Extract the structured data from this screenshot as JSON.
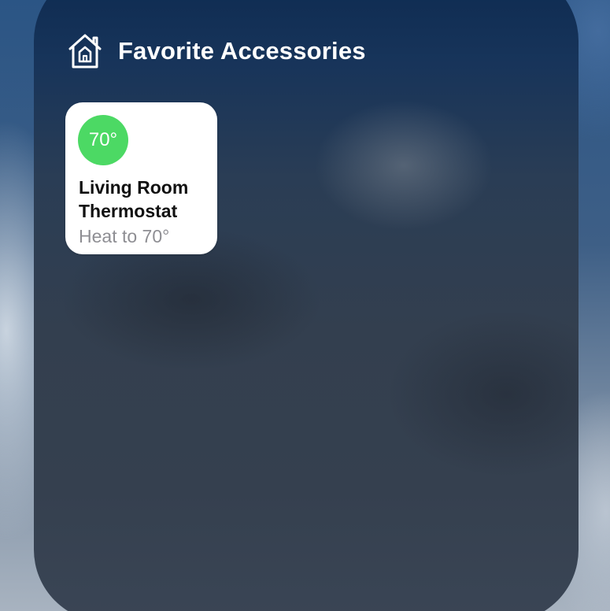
{
  "widget": {
    "title": "Favorite Accessories",
    "icon": "home-icon"
  },
  "accessories": [
    {
      "icon": "thermostat-icon",
      "temperature": "70°",
      "badge_color": "#4cd964",
      "name_line1": "Living Room",
      "name_line2": "Thermostat",
      "status": "Heat to 70°"
    }
  ]
}
